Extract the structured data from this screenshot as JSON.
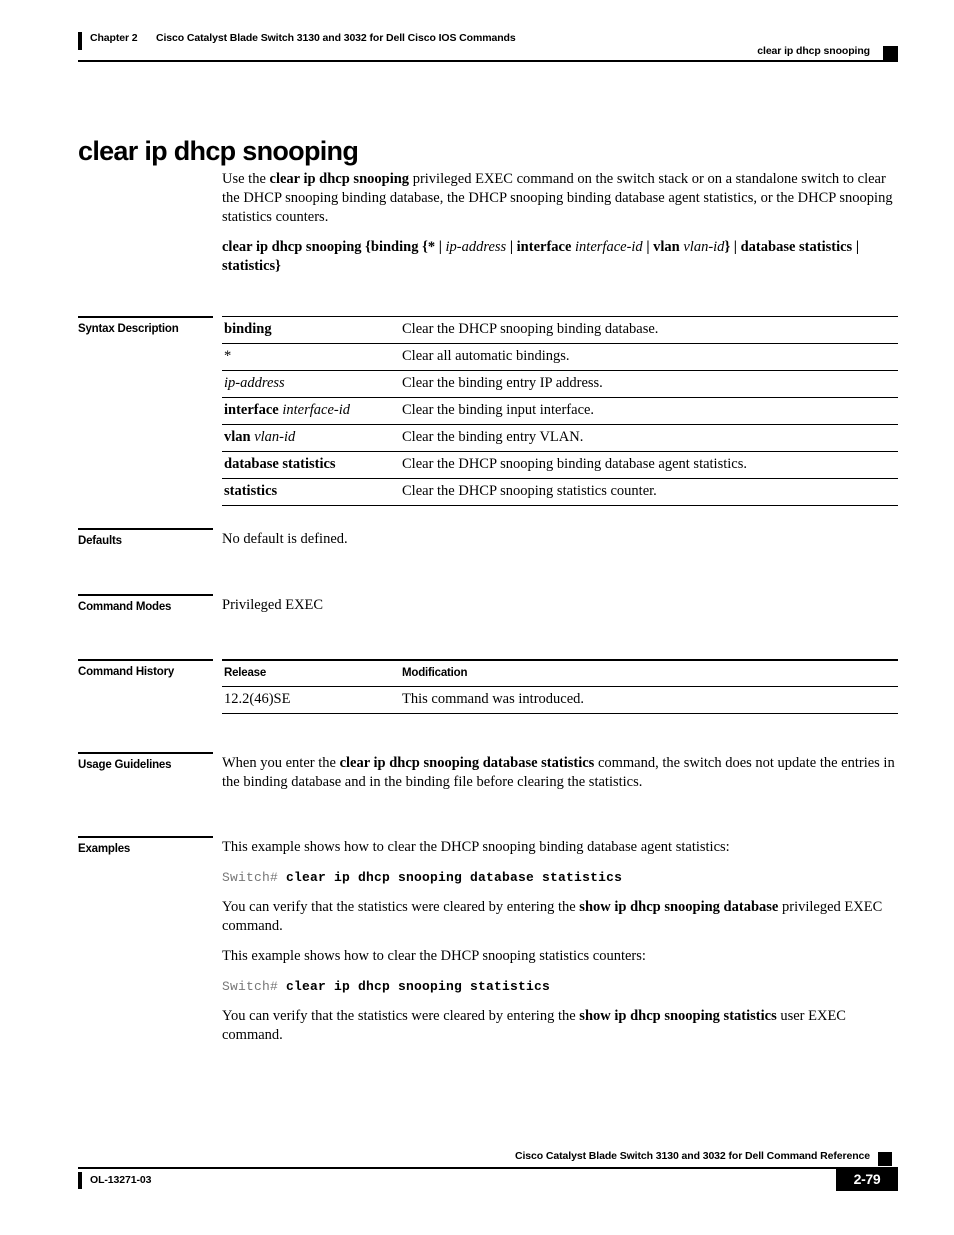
{
  "header": {
    "chapter": "Chapter 2",
    "doc_title": "Cisco Catalyst Blade Switch 3130 and 3032 for Dell Cisco IOS Commands",
    "running_command": "clear ip dhcp snooping"
  },
  "page_title": "clear ip dhcp snooping",
  "intro": {
    "line1_a": "Use the ",
    "line1_b": "clear ip dhcp snooping",
    "line1_c": " privileged EXEC command on the switch stack or on a standalone switch to clear the DHCP snooping binding database, the DHCP snooping binding database agent statistics, or the DHCP snooping statistics counters."
  },
  "syntax_line": {
    "cmd": "clear ip dhcp snooping",
    "open_brace": "{",
    "binding": "binding",
    "brace2": "{",
    "star": "*",
    "bar1": " | ",
    "ip_address": "ip-address",
    "bar2": " | ",
    "interface": "interface",
    "interface_id": "interface-id",
    "bar3": " | ",
    "vlan": "vlan",
    "vlan_id": "vlan-id",
    "close_brace2": "}",
    "bar4": " | ",
    "database_statistics": "database statistics",
    "bar5": " | ",
    "statistics": "statistics",
    "close_brace": "}"
  },
  "sections": {
    "syntax_description": "Syntax Description",
    "defaults": "Defaults",
    "command_modes": "Command Modes",
    "command_history": "Command History",
    "usage_guidelines": "Usage Guidelines",
    "examples": "Examples"
  },
  "syntax_table": {
    "rows": [
      {
        "term": "binding",
        "term_style": "bold",
        "desc": "Clear the DHCP snooping binding database."
      },
      {
        "term": "*",
        "term_style": "plain",
        "desc": "Clear all automatic bindings."
      },
      {
        "term": "ip-address",
        "term_style": "italic",
        "desc": "Clear the binding entry IP address."
      },
      {
        "term": "interface interface-id",
        "term_style": "bold-italic",
        "term_bold": "interface",
        "term_italic": "interface-id",
        "desc": "Clear the binding input interface."
      },
      {
        "term": "vlan vlan-id",
        "term_style": "bold-italic",
        "term_bold": "vlan",
        "term_italic": "vlan-id",
        "desc": "Clear the binding entry VLAN."
      },
      {
        "term": "database statistics",
        "term_style": "bold",
        "desc": "Clear the DHCP snooping binding database agent statistics."
      },
      {
        "term": "statistics",
        "term_style": "bold",
        "desc": "Clear the DHCP snooping statistics counter."
      }
    ]
  },
  "defaults_text": "No default is defined.",
  "command_modes_text": "Privileged EXEC",
  "command_history": {
    "headers": {
      "release": "Release",
      "modification": "Modification"
    },
    "rows": [
      {
        "release": "12.2(46)SE",
        "modification": "This command was introduced."
      }
    ]
  },
  "usage_guidelines": {
    "part_a": "When you enter the ",
    "part_b": "clear ip dhcp snooping database statistics",
    "part_c": " command, the switch does not update the entries in the binding database and in the binding file before clearing the statistics."
  },
  "examples": {
    "intro1": "This example shows how to clear the DHCP snooping binding database agent statistics:",
    "code1_prompt": "Switch# ",
    "code1_cmd": "clear ip dhcp snooping database statistics",
    "verify1_a": "You can verify that the statistics were cleared by entering the ",
    "verify1_b": "show ip dhcp snooping database",
    "verify1_c": " privileged EXEC command.",
    "intro2": "This example shows how to clear the DHCP snooping statistics counters:",
    "code2_prompt": "Switch# ",
    "code2_cmd": "clear ip dhcp snooping statistics",
    "verify2_a": "You can verify that the statistics were cleared by entering the ",
    "verify2_b": "show ip dhcp snooping statistics",
    "verify2_c": " user EXEC command."
  },
  "footer": {
    "doc_title": "Cisco Catalyst Blade Switch 3130 and 3032 for Dell Command Reference",
    "doc_id": "OL-13271-03",
    "page_number": "2-79"
  }
}
